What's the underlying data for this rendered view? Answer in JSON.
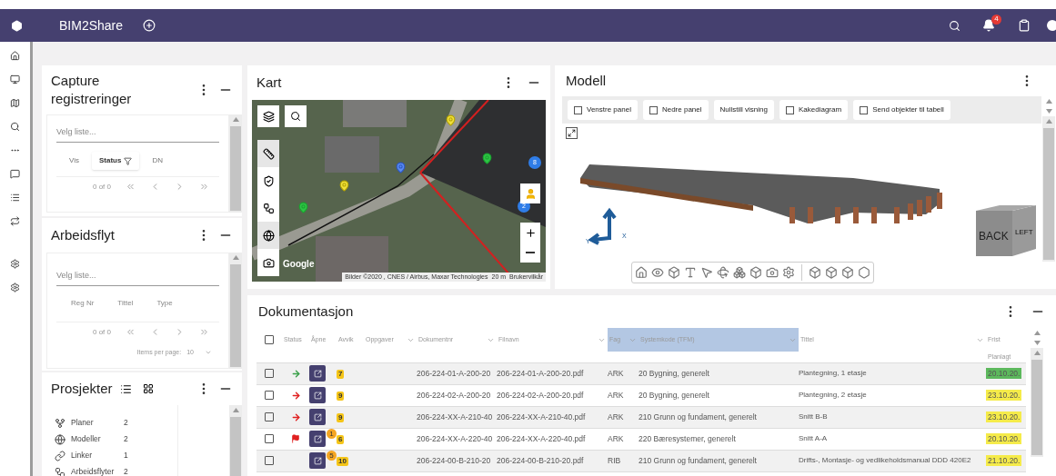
{
  "header": {
    "title": "BIM2Share",
    "notification_count": "4"
  },
  "capture": {
    "title": "Capture registreringer",
    "placeholder": "Velg liste...",
    "columns": [
      {
        "label": "Vis",
        "filtered": false
      },
      {
        "label": "Status",
        "filtered": true
      },
      {
        "label": "DN",
        "filtered": false
      }
    ],
    "pager": "0 of 0"
  },
  "arbeidsflyt": {
    "title": "Arbeidsflyt",
    "placeholder": "Velg liste...",
    "columns": [
      "Reg Nr",
      "Tittel",
      "Type"
    ],
    "pager": "0 of 0",
    "items_per_page_label": "Items per page:",
    "items_per_page": "10"
  },
  "prosjekter": {
    "title": "Prosjekter",
    "items": [
      {
        "label": "Planer",
        "count": "2"
      },
      {
        "label": "Modeller",
        "count": "2"
      },
      {
        "label": "Linker",
        "count": "1"
      },
      {
        "label": "Arbeidsflyter",
        "count": "2"
      }
    ]
  },
  "kart": {
    "title": "Kart",
    "clusters": [
      "8",
      "2"
    ],
    "logo": "Google",
    "attribution": "Bilder ©2020 , CNES / Airbus, Maxar Technologies",
    "scale": "20 m",
    "terms": "Brukervilkår"
  },
  "modell": {
    "title": "Modell",
    "toolbar": [
      {
        "kind": "checkbox",
        "label": "Venstre panel",
        "checked": false
      },
      {
        "kind": "checkbox",
        "label": "Nedre panel",
        "checked": false
      },
      {
        "kind": "button",
        "label": "Nullstill visning"
      },
      {
        "kind": "checkbox",
        "label": "Kakediagram",
        "checked": false
      },
      {
        "kind": "checkbox",
        "label": "Send objekter til tabell",
        "checked": false
      }
    ],
    "cube_faces": [
      "BACK",
      "LEFT"
    ],
    "axes": [
      "Y",
      "X"
    ]
  },
  "dokumentasjon": {
    "title": "Dokumentasjon",
    "columns": [
      {
        "label": "Status",
        "highlighted": false,
        "sortable": false
      },
      {
        "label": "Åpne",
        "highlighted": false,
        "sortable": false
      },
      {
        "label": "Avvik",
        "highlighted": false,
        "sortable": false
      },
      {
        "label": "Oppgaver",
        "highlighted": false,
        "sortable": true
      },
      {
        "label": "Dokumentnr",
        "highlighted": false,
        "sortable": true
      },
      {
        "label": "Filnavn",
        "highlighted": false,
        "sortable": true
      },
      {
        "label": "Fag",
        "highlighted": true,
        "sortable": true
      },
      {
        "label": "Systemkode (TFM)",
        "highlighted": true,
        "sortable": true
      },
      {
        "label": "Tittel",
        "highlighted": false,
        "sortable": true
      },
      {
        "label": "Frist",
        "highlighted": false,
        "sortable": false
      }
    ],
    "all_checked": false,
    "subheader": "Planlagt",
    "rows": [
      {
        "checked": false,
        "status": {
          "kind": "arrow",
          "color": "#3aa14a"
        },
        "avvik": "7",
        "dokumentnr": "206-224-01-A-200-20",
        "filnavn": "206-224-01-A-200-20.pdf",
        "fag": "ARK",
        "systemkode": "20 Bygning, generelt",
        "tittel": "Plantegning, 1 etasje",
        "deadline": {
          "text": "20.10.20.",
          "color": "#5cb85c"
        }
      },
      {
        "checked": false,
        "status": {
          "kind": "arrow",
          "color": "#e02020"
        },
        "avvik": "9",
        "dokumentnr": "206-224-02-A-200-20",
        "filnavn": "206-224-02-A-200-20.pdf",
        "fag": "ARK",
        "systemkode": "20 Bygning, generelt",
        "tittel": "Plantegning, 2 etasje",
        "deadline": {
          "text": "23.10.20.",
          "color": "#f5eb4a"
        }
      },
      {
        "checked": false,
        "status": {
          "kind": "arrow",
          "color": "#e02020"
        },
        "avvik": "9",
        "dokumentnr": "206-224-XX-A-210-40",
        "filnavn": "206-224-XX-A-210-40.pdf",
        "fag": "ARK",
        "systemkode": "210 Grunn og fundament, generelt",
        "tittel": "Snitt B-B",
        "deadline": {
          "text": "23.10.20.",
          "color": "#f5eb4a"
        }
      },
      {
        "checked": false,
        "status": {
          "kind": "flag",
          "color": "#e02020"
        },
        "open_badge": "1",
        "avvik": "6",
        "dokumentnr": "206-224-XX-A-220-40",
        "filnavn": "206-224-XX-A-220-40.pdf",
        "fag": "ARK",
        "systemkode": "220 Bæresystemer, generelt",
        "tittel": "Snitt A-A",
        "deadline": {
          "text": "20.10.20.",
          "color": "#f5eb4a"
        }
      },
      {
        "checked": false,
        "open_badge": "5",
        "avvik": "10",
        "dokumentnr": "206-224-00-B-210-20",
        "filnavn": "206-224-00-B-210-20.pdf",
        "fag": "RIB",
        "systemkode": "210 Grunn og fundament, generelt",
        "tittel": "Drifts-, Montasje- og vedlikeholdsmanual DDD 420E2",
        "deadline": {
          "text": "21.10.20.",
          "color": "#f5eb4a"
        }
      }
    ]
  }
}
